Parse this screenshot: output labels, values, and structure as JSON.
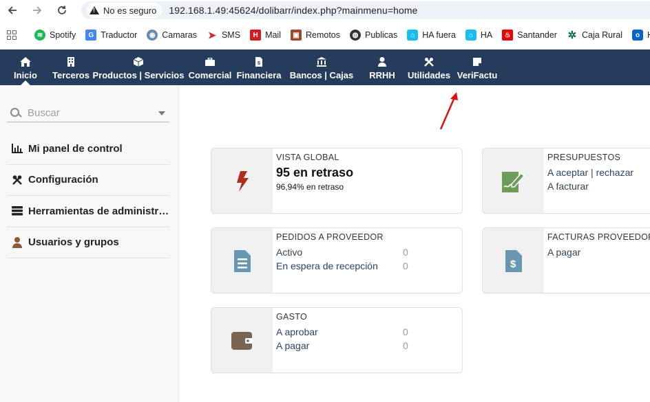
{
  "browser": {
    "security_label": "No es seguro",
    "url": "192.168.1.49:45624/dolibarr/index.php?mainmenu=home",
    "bookmarks": [
      {
        "label": "Spotify",
        "icon": "spotify-icon",
        "color": "#1db954"
      },
      {
        "label": "Traductor",
        "icon": "translate-icon",
        "color": "#4285f4"
      },
      {
        "label": "Camaras",
        "icon": "camera-icon",
        "color": "#6a8ab0"
      },
      {
        "label": "SMS",
        "icon": "sms-icon",
        "color": "#e0242c"
      },
      {
        "label": "Mail",
        "icon": "mail-icon",
        "color": "#d71920"
      },
      {
        "label": "Remotos",
        "icon": "remote-icon",
        "color": "#9c4a2a"
      },
      {
        "label": "Publicas",
        "icon": "globe-icon",
        "color": "#333333"
      },
      {
        "label": "HA fuera",
        "icon": "home-assistant-icon",
        "color": "#18bcf2"
      },
      {
        "label": "HA",
        "icon": "home-assistant-icon",
        "color": "#18bcf2"
      },
      {
        "label": "Santander",
        "icon": "santander-icon",
        "color": "#ec0000"
      },
      {
        "label": "Caja Rural",
        "icon": "caja-rural-icon",
        "color": "#0a6b3a"
      },
      {
        "label": "H",
        "icon": "outlook-icon",
        "color": "#0a64c8"
      }
    ]
  },
  "topmenu": {
    "items": [
      {
        "label": "Inicio",
        "icon": "home-icon",
        "active": true
      },
      {
        "label": "Terceros",
        "icon": "building-icon",
        "active": false
      },
      {
        "label": "Productos | Servicios",
        "icon": "cube-icon",
        "active": false
      },
      {
        "label": "Comercial",
        "icon": "briefcase-icon",
        "active": false
      },
      {
        "label": "Financiera",
        "icon": "invoice-icon",
        "active": false
      },
      {
        "label": "Bancos | Cajas",
        "icon": "bank-icon",
        "active": false
      },
      {
        "label": "RRHH",
        "icon": "user-icon",
        "active": false
      },
      {
        "label": "Utilidades",
        "icon": "tools-icon",
        "active": false
      },
      {
        "label": "VeriFactu",
        "icon": "note-icon",
        "active": false
      }
    ]
  },
  "leftpanel": {
    "search_placeholder": "Buscar",
    "items": [
      {
        "label": "Mi panel de control",
        "icon": "chart-icon"
      },
      {
        "label": "Configuración",
        "icon": "tools-icon"
      },
      {
        "label": "Herramientas de administración",
        "icon": "server-icon"
      },
      {
        "label": "Usuarios y grupos",
        "icon": "user-icon"
      }
    ]
  },
  "boxes": {
    "vista_global": {
      "title": "VISTA GLOBAL",
      "big_value": "95 en retraso",
      "sub_value": "96,94% en retraso",
      "icon_color": "#b02d1f"
    },
    "presupuestos": {
      "title": "PRESUPUESTOS",
      "line1": "A aceptar | rechazar",
      "line2": "A facturar",
      "icon_color": "#6d9b59"
    },
    "pedidos_proveedor": {
      "title": "PEDIDOS A PROVEEDOR",
      "rows": [
        {
          "label": "Activo",
          "value": "0"
        },
        {
          "label": "En espera de recepción",
          "value": "0"
        }
      ],
      "icon_color": "#6a97b0"
    },
    "facturas_proveedor": {
      "title": "FACTURAS PROVEEDOR",
      "line1": "A pagar",
      "icon_color": "#6a97b0"
    },
    "gasto": {
      "title": "GASTO",
      "rows": [
        {
          "label": "A aprobar",
          "value": "0"
        },
        {
          "label": "A pagar",
          "value": "0"
        }
      ],
      "icon_color": "#7a6451"
    }
  },
  "colors": {
    "topmenu_bg": "#263c5c",
    "annotation_arrow": "#e01010"
  }
}
